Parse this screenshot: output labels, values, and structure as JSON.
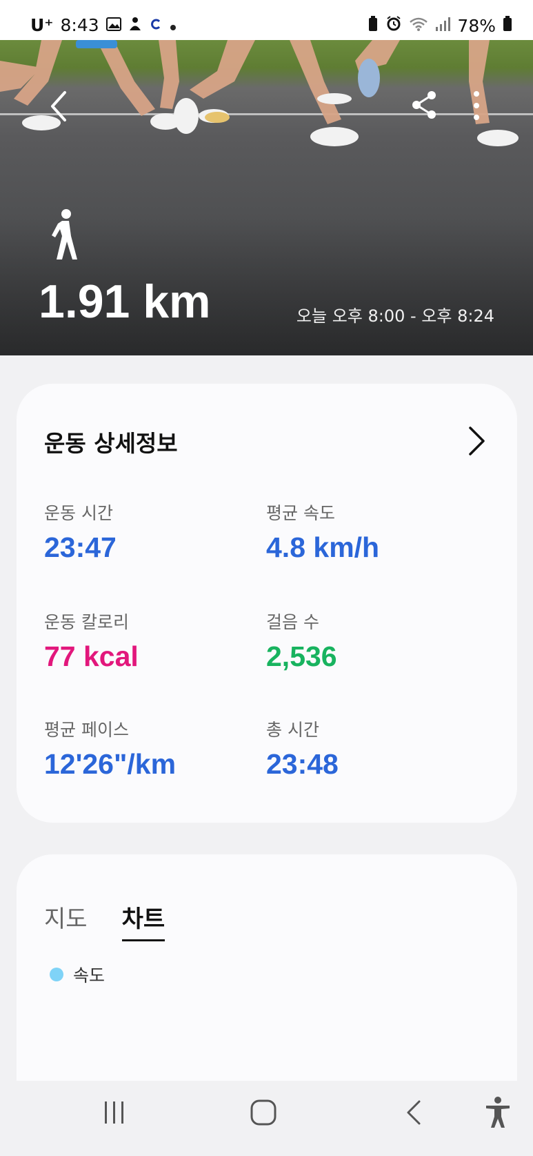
{
  "status_bar": {
    "carrier": "U⁺",
    "time": "8:43",
    "battery": "78%",
    "left_icons": [
      "gallery-icon",
      "user-icon",
      "c-app-icon",
      "dot-icon"
    ],
    "right_icons": [
      "battery-saver-icon",
      "alarm-icon",
      "wifi-icon",
      "signal-icon",
      "battery-icon"
    ]
  },
  "hero": {
    "distance": "1.91 km",
    "time_range": "오늘 오후 8:00 - 오후 8:24",
    "exercise_icon": "walk-icon"
  },
  "details": {
    "title": "운동 상세정보",
    "metrics": [
      {
        "label": "운동 시간",
        "value": "23:47",
        "color": "#2b66d9"
      },
      {
        "label": "평균 속도",
        "value": "4.8 km/h",
        "color": "#2b66d9"
      },
      {
        "label": "운동 칼로리",
        "value": "77 kcal",
        "color": "#e2177c"
      },
      {
        "label": "걸음 수",
        "value": "2,536",
        "color": "#18b35f"
      },
      {
        "label": "평균 페이스",
        "value": "12'26\"/km",
        "color": "#2b66d9"
      },
      {
        "label": "총 시간",
        "value": "23:48",
        "color": "#2b66d9"
      }
    ]
  },
  "chart_section": {
    "tabs": [
      {
        "label": "지도",
        "active": false
      },
      {
        "label": "차트",
        "active": true
      }
    ],
    "legend_label": "속도",
    "legend_color": "#7fd3f7"
  },
  "nav": {
    "icons": [
      "recents-icon",
      "home-icon",
      "back-icon",
      "accessibility-icon"
    ]
  }
}
